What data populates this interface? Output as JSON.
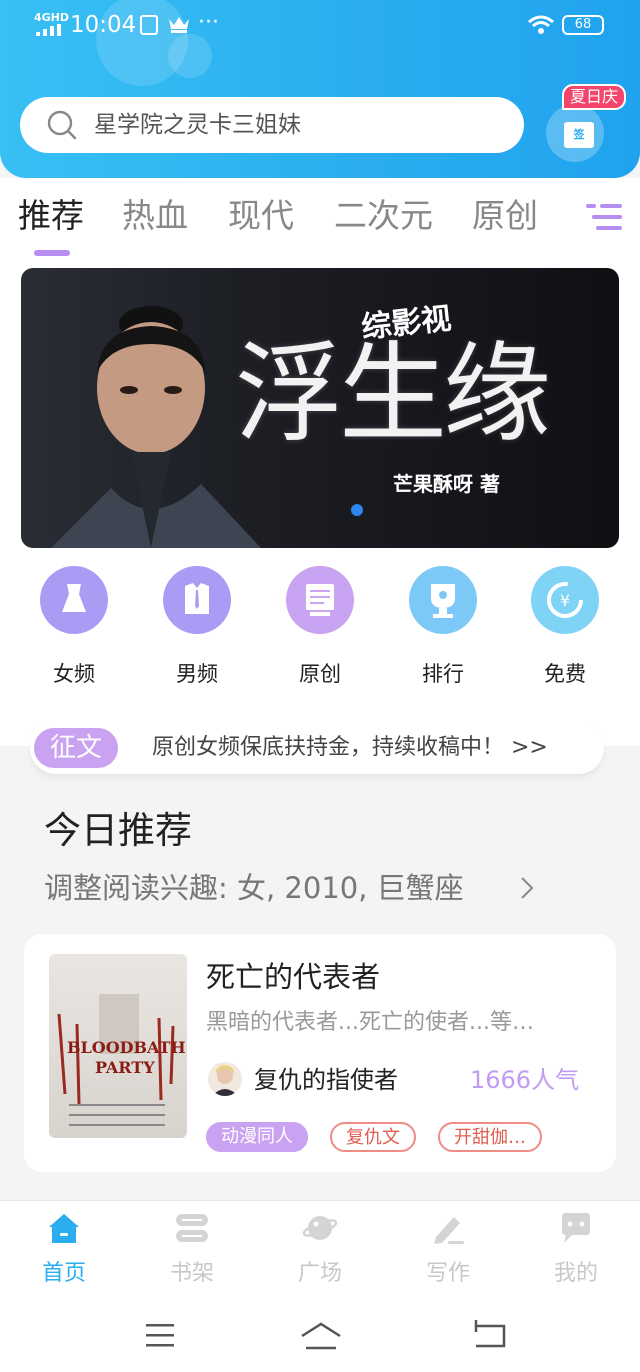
{
  "statusbar": {
    "network": "4GHD",
    "time": "10:04",
    "more": "···",
    "battery": "68"
  },
  "search": {
    "placeholder": "星学院之灵卡三姐妹"
  },
  "checkin": {
    "badge": "夏日庆",
    "label": "签"
  },
  "tabs": [
    {
      "label": "推荐",
      "active": true
    },
    {
      "label": "热血"
    },
    {
      "label": "现代"
    },
    {
      "label": "二次元"
    },
    {
      "label": "原创"
    }
  ],
  "banner": {
    "tag": "综影视",
    "title": "浮生缘",
    "author": "芒果酥呀 著"
  },
  "categories": [
    {
      "label": "女频",
      "icon": "dress-icon",
      "color": "#a99cf5"
    },
    {
      "label": "男频",
      "icon": "shirt-icon",
      "color": "#a99cf5"
    },
    {
      "label": "原创",
      "icon": "book-icon",
      "color": "#c8a4f2"
    },
    {
      "label": "排行",
      "icon": "trophy-icon",
      "color": "#7cc8f6"
    },
    {
      "label": "免费",
      "icon": "yuan-coin-icon",
      "color": "#7fd3f5"
    }
  ],
  "notice": {
    "tag": "征文",
    "text": "原创女频保底扶持金，持续收稿中！ >>"
  },
  "today": {
    "title": "今日推荐",
    "subtitle": "调整阅读兴趣: 女, 2010, 巨蟹座"
  },
  "book": {
    "title": "死亡的代表者",
    "desc": "黑暗的代表者...死亡的使者...等…",
    "author": "复仇的指使者",
    "popularity": "1666人气",
    "cover_title_1": "BLOODBATH",
    "cover_title_2": "PARTY",
    "tags": [
      "动漫同人",
      "复仇文",
      "开甜伽…"
    ]
  },
  "bottom_nav": [
    {
      "label": "首页",
      "icon": "home-icon",
      "active": true
    },
    {
      "label": "书架",
      "icon": "bookshelf-icon"
    },
    {
      "label": "广场",
      "icon": "planet-icon"
    },
    {
      "label": "写作",
      "icon": "pen-icon"
    },
    {
      "label": "我的",
      "icon": "chat-icon"
    }
  ],
  "colors": {
    "accent": "#2aaef0",
    "purple": "#c9a3f2",
    "tag_red": "#e25c52"
  }
}
